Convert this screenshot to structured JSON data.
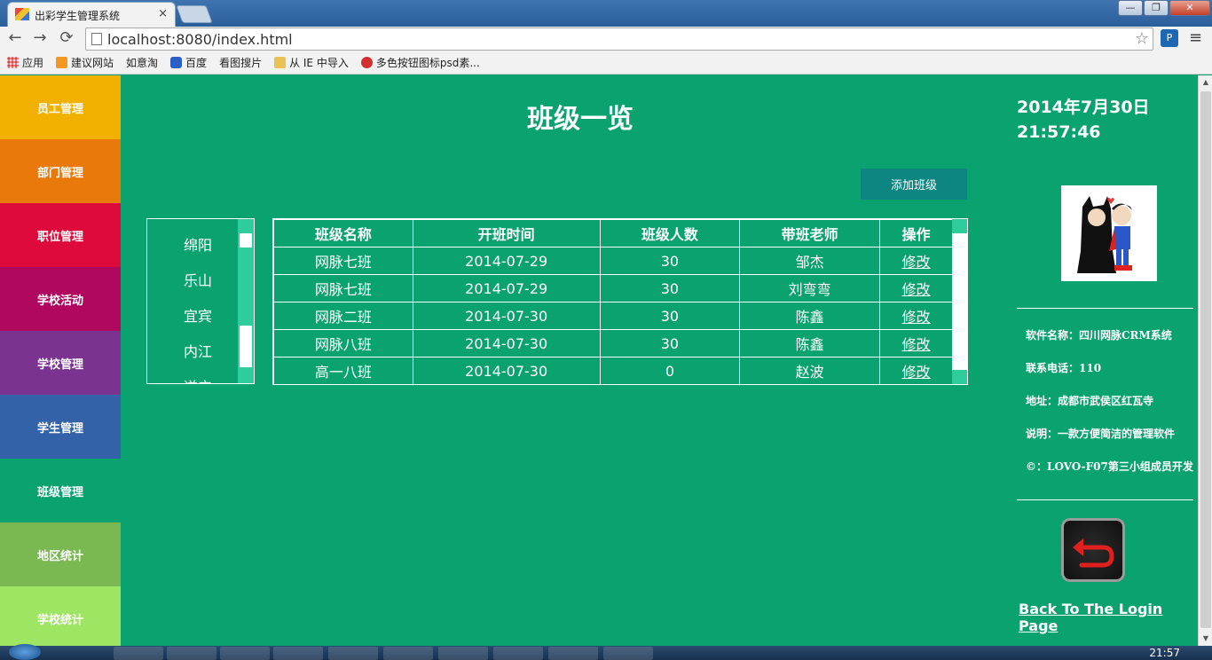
{
  "browser": {
    "tab_title": "出彩学生管理系统",
    "tab_close": "×",
    "url": "localhost:8080/index.html",
    "window_min": "—",
    "window_max": "❐",
    "window_close": "✕",
    "ext_label": "P",
    "nav_icons": {
      "back": "←",
      "forward": "→",
      "reload": "⟳",
      "star": "☆",
      "menu": "≡"
    },
    "bookmarks": [
      {
        "label": "应用",
        "icon": "apps-icon"
      },
      {
        "label": "建议网站",
        "icon": "suggest-icon"
      },
      {
        "label": "如意淘",
        "icon": "page-icon"
      },
      {
        "label": "百度",
        "icon": "baidu-paw-icon"
      },
      {
        "label": "看图搜片",
        "icon": "page-icon"
      },
      {
        "label": "从 IE 中导入",
        "icon": "folder-icon"
      },
      {
        "label": "多色按钮图标psd素...",
        "icon": "red-circle-icon"
      }
    ]
  },
  "sidebar": {
    "items": [
      {
        "label": "员工管理",
        "color": "#f2b000"
      },
      {
        "label": "部门管理",
        "color": "#e8790a"
      },
      {
        "label": "职位管理",
        "color": "#de0a3c"
      },
      {
        "label": "学校活动",
        "color": "#b0085e"
      },
      {
        "label": "学校管理",
        "color": "#7a3390"
      },
      {
        "label": "学生管理",
        "color": "#3462a8"
      },
      {
        "label": "班级管理",
        "color": "#0aa26e"
      },
      {
        "label": "地区统计",
        "color": "#7ab851"
      },
      {
        "label": "学校统计",
        "color": "#9ee564"
      }
    ]
  },
  "main": {
    "title": "班级一览",
    "add_button": "添加班级",
    "regions": [
      "绵阳",
      "乐山",
      "宜宾",
      "内江",
      "遂宁"
    ],
    "table": {
      "headers": [
        "班级名称",
        "开班时间",
        "班级人数",
        "带班老师",
        "操作"
      ],
      "rows": [
        {
          "name": "网脉七班",
          "time": "2014-07-29",
          "count": "30",
          "teacher": "邹杰",
          "action": "修改"
        },
        {
          "name": "网脉七班",
          "time": "2014-07-29",
          "count": "30",
          "teacher": "刘弯弯",
          "action": "修改"
        },
        {
          "name": "网脉二班",
          "time": "2014-07-30",
          "count": "30",
          "teacher": "陈鑫",
          "action": "修改"
        },
        {
          "name": "网脉八班",
          "time": "2014-07-30",
          "count": "30",
          "teacher": "陈鑫",
          "action": "修改"
        },
        {
          "name": "高一八班",
          "time": "2014-07-30",
          "count": "0",
          "teacher": "赵波",
          "action": "修改"
        }
      ]
    }
  },
  "right_panel": {
    "date": "2014年7月30日",
    "time": "21:57:46",
    "info": [
      "软件名称：四川网脉CRM系统",
      "联系电话：110",
      "地址：成都市武侯区红瓦寺",
      "说明：一款方便简洁的管理软件",
      "©：LOVO-F07第三小组成员开发"
    ],
    "back_link": "Back To The Login Page"
  },
  "taskbar": {
    "clock": "21:57"
  }
}
